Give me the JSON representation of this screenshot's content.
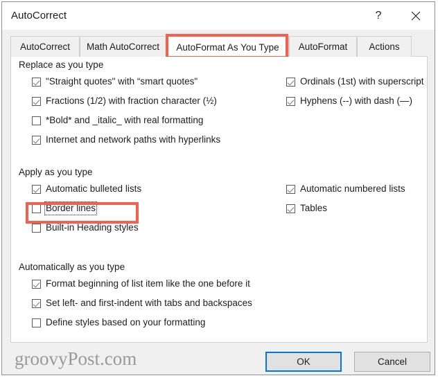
{
  "window": {
    "title": "AutoCorrect",
    "help_icon": "question-mark-icon",
    "help_label": "?",
    "close_icon": "close-icon",
    "close_label": "✕"
  },
  "tabs": [
    {
      "label": "AutoCorrect",
      "active": false
    },
    {
      "label": "Math AutoCorrect",
      "active": false
    },
    {
      "label": "AutoFormat As You Type",
      "active": true
    },
    {
      "label": "AutoFormat",
      "active": false
    },
    {
      "label": "Actions",
      "active": false
    }
  ],
  "groups": [
    {
      "title": "Replace as you type",
      "left_items": [
        {
          "label": "\"Straight quotes\" with “smart quotes\"",
          "checked": true,
          "focused": false
        },
        {
          "label": "Fractions (1/2) with fraction character (½)",
          "checked": true,
          "focused": false
        },
        {
          "label": "*Bold* and _italic_ with real formatting",
          "checked": false,
          "focused": false
        },
        {
          "label": "Internet and network paths with hyperlinks",
          "checked": true,
          "focused": false
        }
      ],
      "right_items": [
        {
          "label": "Ordinals (1st) with superscript",
          "checked": true,
          "focused": false
        },
        {
          "label": "Hyphens (--) with dash (—)",
          "checked": true,
          "focused": false
        }
      ]
    },
    {
      "title": "Apply as you type",
      "left_items": [
        {
          "label": "Automatic bulleted lists",
          "checked": true,
          "focused": false
        },
        {
          "label": "Border lines",
          "checked": false,
          "focused": true
        },
        {
          "label": "Built-in Heading styles",
          "checked": false,
          "focused": false
        }
      ],
      "right_items": [
        {
          "label": "Automatic numbered lists",
          "checked": true,
          "focused": false
        },
        {
          "label": "Tables",
          "checked": true,
          "focused": false
        }
      ]
    },
    {
      "title": "Automatically as you type",
      "left_items": [
        {
          "label": "Format beginning of list item like the one before it",
          "checked": true,
          "focused": false
        },
        {
          "label": "Set left- and first-indent with tabs and backspaces",
          "checked": true,
          "focused": false
        },
        {
          "label": "Define styles based on your formatting",
          "checked": false,
          "focused": false
        }
      ],
      "right_items": []
    }
  ],
  "footer": {
    "watermark": "groovyPost.com",
    "ok_label": "OK",
    "cancel_label": "Cancel"
  },
  "annotations": {
    "accent_color": "#f4604e",
    "focus_color": "#0078d7"
  }
}
